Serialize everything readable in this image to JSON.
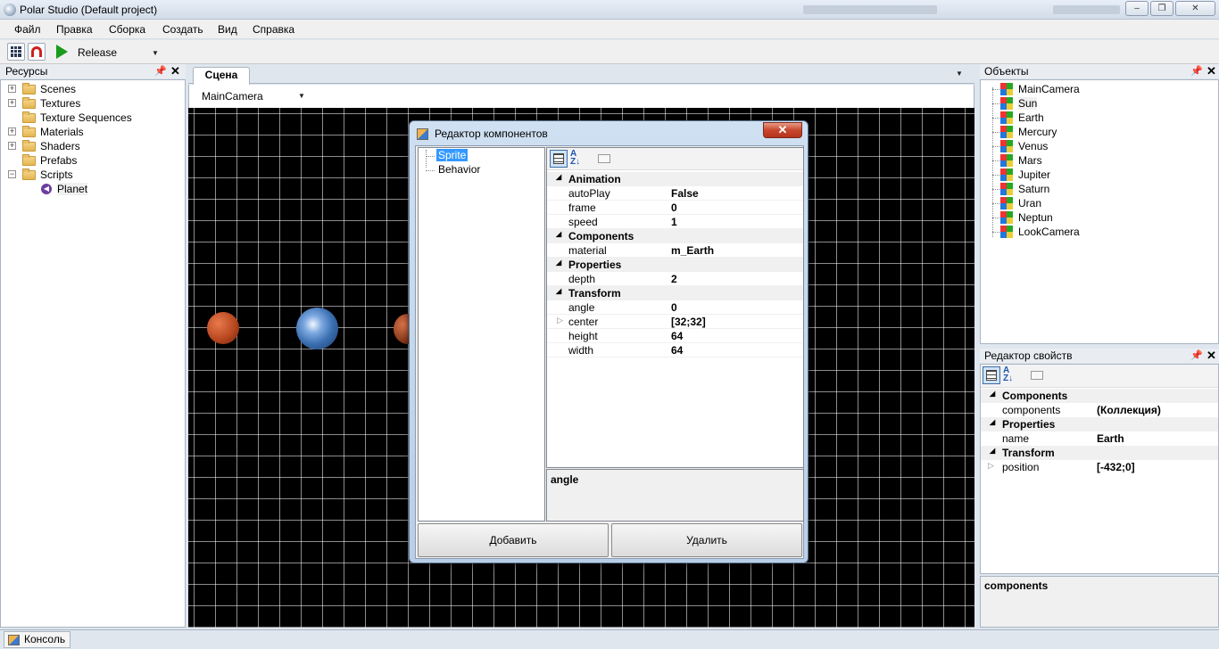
{
  "window": {
    "title": "Polar Studio (Default project)",
    "buttons": {
      "minimize": "‒",
      "maximize": "❐",
      "close": "✕"
    }
  },
  "menu": [
    "Файл",
    "Правка",
    "Сборка",
    "Создать",
    "Вид",
    "Справка"
  ],
  "toolbar": {
    "config": "Release"
  },
  "resources": {
    "title": "Ресурсы",
    "items": [
      {
        "label": "Scenes",
        "expandable": true
      },
      {
        "label": "Textures",
        "expandable": true
      },
      {
        "label": "Texture Sequences",
        "expandable": false
      },
      {
        "label": "Materials",
        "expandable": true
      },
      {
        "label": "Shaders",
        "expandable": true
      },
      {
        "label": "Prefabs",
        "expandable": false
      },
      {
        "label": "Scripts",
        "expandable": true,
        "expanded": true
      },
      {
        "label": "Planet",
        "child": true
      }
    ]
  },
  "scene": {
    "tab": "Сцена",
    "camera": "MainCamera",
    "planets": [
      {
        "name": "Mars",
        "color": "#b9481f"
      },
      {
        "name": "Earth",
        "color": "#3a6fb0"
      },
      {
        "name": "Mercury",
        "color": "#8a3b1c"
      }
    ]
  },
  "component_editor": {
    "title": "Редактор компонентов",
    "components": [
      "Sprite",
      "Behavior"
    ],
    "selected": "Sprite",
    "properties": [
      {
        "category": "Animation"
      },
      {
        "label": "autoPlay",
        "value": "False"
      },
      {
        "label": "frame",
        "value": "0"
      },
      {
        "label": "speed",
        "value": "1"
      },
      {
        "category": "Components"
      },
      {
        "label": "material",
        "value": "m_Earth"
      },
      {
        "category": "Properties"
      },
      {
        "label": "depth",
        "value": "2"
      },
      {
        "category": "Transform"
      },
      {
        "label": "angle",
        "value": "0"
      },
      {
        "label": "center",
        "value": "[32;32]",
        "expandable": true
      },
      {
        "label": "height",
        "value": "64"
      },
      {
        "label": "width",
        "value": "64"
      }
    ],
    "description": "angle",
    "add_button": "Добавить",
    "delete_button": "Удалить"
  },
  "objects": {
    "title": "Объекты",
    "items": [
      "MainCamera",
      "Sun",
      "Earth",
      "Mercury",
      "Venus",
      "Mars",
      "Jupiter",
      "Saturn",
      "Uran",
      "Neptun",
      "LookCamera"
    ],
    "highlighted": "Sun"
  },
  "property_editor": {
    "title": "Редактор свойств",
    "properties": [
      {
        "category": "Components"
      },
      {
        "label": "components",
        "value": "(Коллекция)"
      },
      {
        "category": "Properties"
      },
      {
        "label": "name",
        "value": "Earth"
      },
      {
        "category": "Transform"
      },
      {
        "label": "position",
        "value": "[-432;0]",
        "expandable": true
      }
    ],
    "description": "components"
  },
  "statusbar": {
    "console_tab": "Консоль"
  }
}
